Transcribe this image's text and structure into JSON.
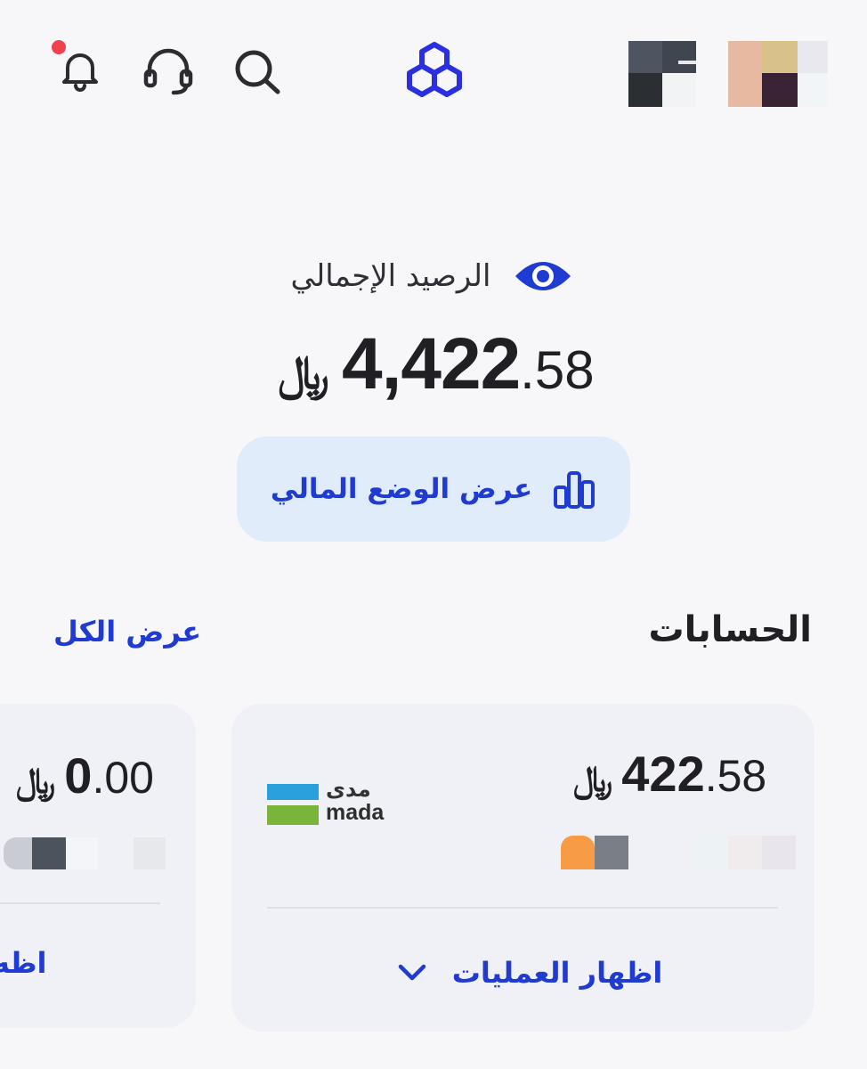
{
  "header": {
    "icons": [
      "bell-icon",
      "headset-icon",
      "search-icon",
      "logo-icon"
    ],
    "notification_dot_color": "#f2414a",
    "accent_color": "#1f3bd1"
  },
  "balance": {
    "label": "الرصيد الإجمالي",
    "currency_symbol": "﷼",
    "amount_integer": "4,422",
    "amount_decimal": ".58",
    "financial_status_button": "عرض الوضع المالي"
  },
  "accounts": {
    "title": "الحسابات",
    "view_all": "عرض الكل",
    "cards": [
      {
        "currency_symbol": "﷼",
        "amount_integer": "422",
        "amount_decimal": ".58",
        "card_network_arabic": "مدى",
        "card_network_english": "mada",
        "action_label": "اظهار العمليات"
      },
      {
        "currency_symbol": "﷼",
        "amount_integer": "0",
        "amount_decimal": ".00",
        "action_label_partial": "اظه"
      }
    ]
  }
}
